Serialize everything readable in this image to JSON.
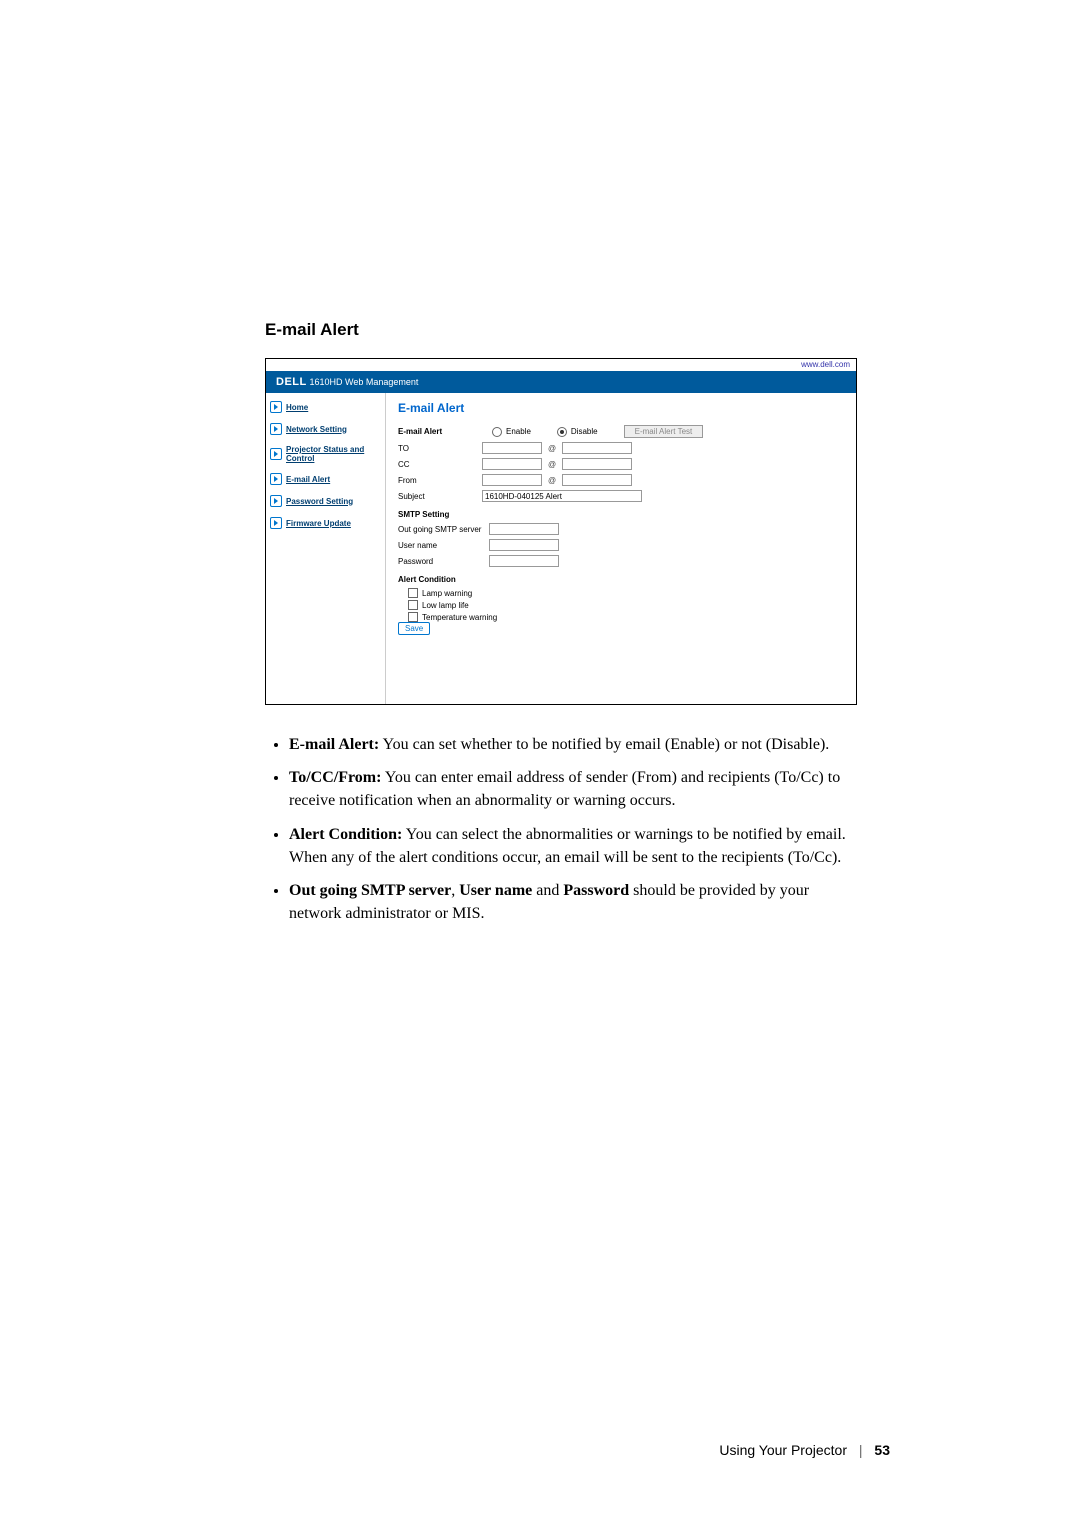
{
  "section_title": "E-mail Alert",
  "url_bar": "www.dell.com",
  "header": {
    "logo": "DELL",
    "product": "1610HD Web Management"
  },
  "nav": {
    "items": [
      "Home",
      "Network Setting",
      "Projector Status and Control",
      "E-mail Alert",
      "Password Setting",
      "Firmware Update"
    ]
  },
  "panel": {
    "title": "E-mail Alert",
    "email_alert_label": "E-mail Alert",
    "enable": "Enable",
    "disable": "Disable",
    "test_btn": "E-mail Alert Test",
    "to": "TO",
    "cc": "CC",
    "from": "From",
    "subject_label": "Subject",
    "subject_value": "1610HD-040125 Alert",
    "smtp_header": "SMTP Setting",
    "smtp_server": "Out going SMTP server",
    "user": "User name",
    "pwd": "Password",
    "alert_header": "Alert Condition",
    "cond1": "Lamp warning",
    "cond2": "Low lamp life",
    "cond3": "Temperature warning",
    "save": "Save"
  },
  "body_bullets": {
    "b1_label": "E-mail Alert:",
    "b1_text": " You can set whether to be notified by email (Enable) or not (Disable).",
    "b2_label": "To/CC/From:",
    "b2_text": " You can enter email address of sender (From) and recipients (To/Cc) to receive notification when an abnormality or warning occurs.",
    "b3_label": "Alert Condition:",
    "b3_text": " You can select the abnormalities or warnings to be notified by email. When any of the alert conditions occur, an email will be sent to the recipients (To/Cc).",
    "b4_label1": "Out going SMTP server",
    "b4_mid": ", ",
    "b4_label2": "User name",
    "b4_and": " and ",
    "b4_label3": "Password",
    "b4_text": " should be provided by your network administrator or MIS."
  },
  "footer": {
    "label": "Using Your Projector",
    "page": "53"
  }
}
